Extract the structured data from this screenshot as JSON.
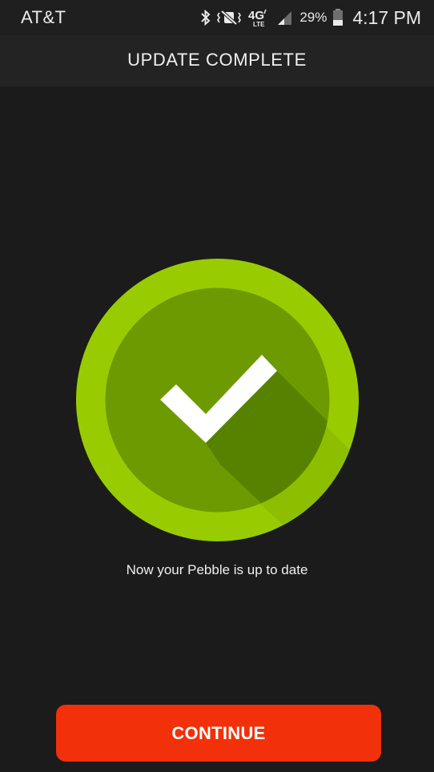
{
  "status_bar": {
    "carrier": "AT&T",
    "battery_percent": "29%",
    "time": "4:17 PM",
    "network_label": "4G",
    "network_sub": "LTE",
    "icons": [
      "bluetooth-icon",
      "vibrate-icon",
      "network-4g-lte-icon",
      "signal-icon",
      "battery-icon"
    ]
  },
  "header": {
    "title": "UPDATE COMPLETE"
  },
  "main": {
    "success_icon": "checkmark-icon",
    "message": "Now your Pebble is up to date"
  },
  "footer": {
    "continue_label": "CONTINUE"
  },
  "colors": {
    "background": "#1b1b1b",
    "outer_ring": "#99cc00",
    "inner_circle": "#6d9a00",
    "check_shadow": "#578200",
    "button": "#f2300a"
  }
}
